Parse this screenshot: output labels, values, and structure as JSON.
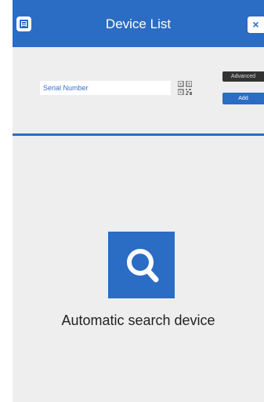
{
  "header": {
    "title": "Device List",
    "menu_icon": "menu-icon",
    "close_label": "×"
  },
  "form": {
    "serial_placeholder": "Serial Number",
    "qr_icon": "qr-code-icon",
    "advanced_label": "Advanced",
    "add_label": "Add"
  },
  "search": {
    "icon": "magnifier-icon",
    "label": "Automatic search device"
  },
  "colors": {
    "accent": "#2b6cc4",
    "background": "#eeeeee",
    "advanced_button": "#333333"
  }
}
